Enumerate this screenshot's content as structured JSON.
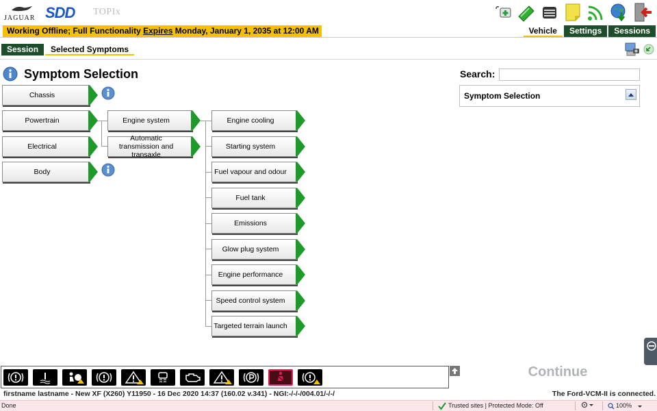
{
  "brand": {
    "jaguar_word": "JAGUAR",
    "app_name": "SDD",
    "module": "TOPIx"
  },
  "toolbar_icons": [
    "medical-kit-icon",
    "green-cable-icon",
    "vcm-box-icon",
    "sticky-note-icon",
    "wireless-signal-icon",
    "globe-download-icon",
    "exit-door-icon"
  ],
  "offline_banner": {
    "prefix": "Working Offline; Full Functionality ",
    "underlined": "Expires",
    "suffix": " Monday, January 1, 2035 at 12:00 AM"
  },
  "main_tabs": [
    {
      "label": "Vehicle",
      "active": true
    },
    {
      "label": "Settings",
      "active": false
    },
    {
      "label": "Sessions",
      "active": false
    }
  ],
  "sub_tabs": [
    {
      "label": "Session",
      "active": false
    },
    {
      "label": "Selected Symptoms",
      "active": true
    }
  ],
  "page_title": "Symptom Selection",
  "categories": {
    "chassis": "Chassis",
    "powertrain": "Powertrain",
    "electrical": "Electrical",
    "body": "Body"
  },
  "systems": {
    "engine_system": "Engine system",
    "auto_trans": "Automatic transmission and transaxle"
  },
  "symptoms": [
    "Engine cooling",
    "Starting system",
    "Fuel vapour and odour",
    "Fuel tank",
    "Emissions",
    "Glow plug system",
    "Engine performance",
    "Speed control system",
    "Targeted terrain launch"
  ],
  "search": {
    "label": "Search:",
    "value": ""
  },
  "panel": {
    "title": "Symptom Selection"
  },
  "warning_icons": [
    "brake-warning-icon",
    "coolant-temp-icon",
    "airbag-warning-icon",
    "brake-circle-icon",
    "hazard-triangle-icon",
    "traction-control-icon",
    "engine-check-icon",
    "hazard-triangle-icon",
    "parking-brake-icon",
    "seatbelt-warning-icon",
    "general-warning-icon"
  ],
  "continue_label": "Continue",
  "status": {
    "left": "firstname lastname - New XF (X260) Y11950 - 16 Dec 2020 14:37 (160.02 v.341) - NGI:-/-/-/004.01/-/-/",
    "right": "The Ford-VCM-II is connected."
  },
  "ie": {
    "done": "Done",
    "trusted": "Trusted sites | Protected Mode: Off",
    "zoom": "100%"
  },
  "colors": {
    "accent_green": "#1e4d2b",
    "banner_yellow": "#f4c000",
    "arrow_green": "#1d9a2a",
    "sdd_blue": "#1a55c9"
  }
}
